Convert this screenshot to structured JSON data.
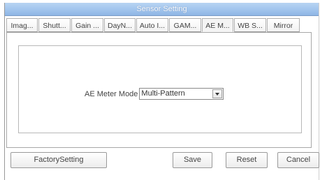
{
  "window": {
    "title": "Sensor Setting"
  },
  "tabs": [
    {
      "label": "Imag...",
      "active": false
    },
    {
      "label": "Shutt...",
      "active": false
    },
    {
      "label": "Gain ...",
      "active": false
    },
    {
      "label": "DayN...",
      "active": false
    },
    {
      "label": "Auto I...",
      "active": false
    },
    {
      "label": "GAM...",
      "active": false
    },
    {
      "label": "AE M...",
      "active": true
    },
    {
      "label": "WB S...",
      "active": false
    },
    {
      "label": "Mirror",
      "active": false
    }
  ],
  "ae_meter": {
    "label": "AE Meter Mode",
    "selected": "Multi-Pattern"
  },
  "buttons": {
    "factory": "FactorySetting",
    "save": "Save",
    "reset": "Reset",
    "cancel": "Cancel"
  },
  "colors": {
    "titlebar": "#a3c6ee",
    "titlebar_text": "#ffffff"
  }
}
